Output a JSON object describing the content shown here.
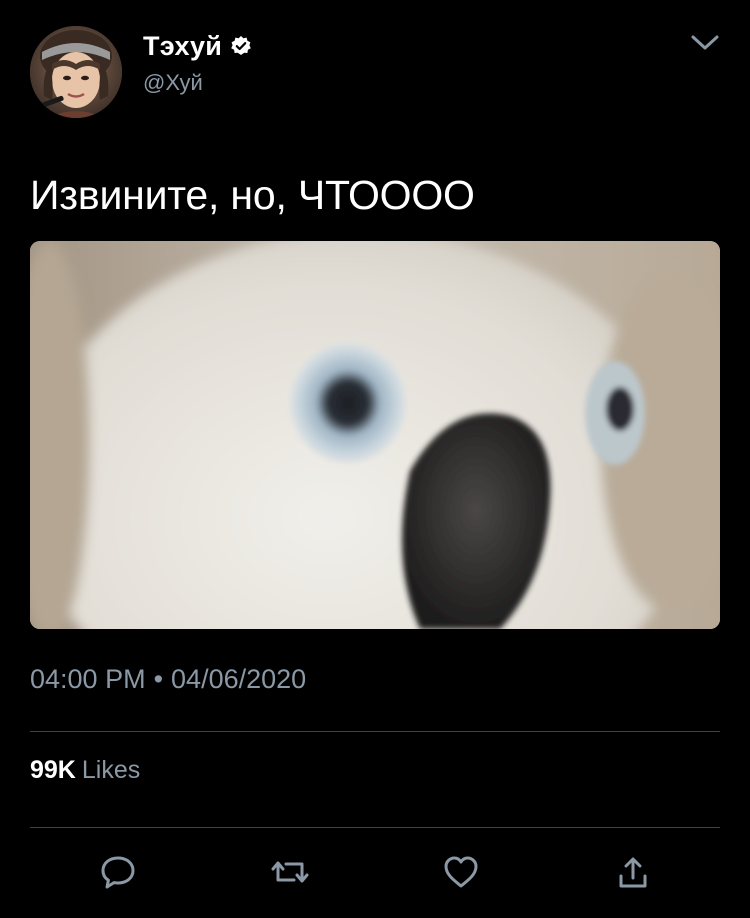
{
  "author": {
    "display_name": "Тэхуй",
    "handle": "@Хуй",
    "verified": true,
    "avatar_icon": "avatar-photo"
  },
  "tweet": {
    "text": "Извините, но, ЧТОООО",
    "media_description_icon": "cockatoo-photo",
    "time": "04:00 PM",
    "separator": "•",
    "date": "04/06/2020"
  },
  "stats": {
    "likes_count": "99K",
    "likes_label": "Likes"
  },
  "actions": {
    "icons": [
      "reply-icon",
      "retweet-icon",
      "like-icon",
      "share-icon"
    ]
  },
  "colors": {
    "background": "#000000",
    "primary_text": "#ffffff",
    "secondary_text": "#8b98a5",
    "divider": "#38444d"
  }
}
